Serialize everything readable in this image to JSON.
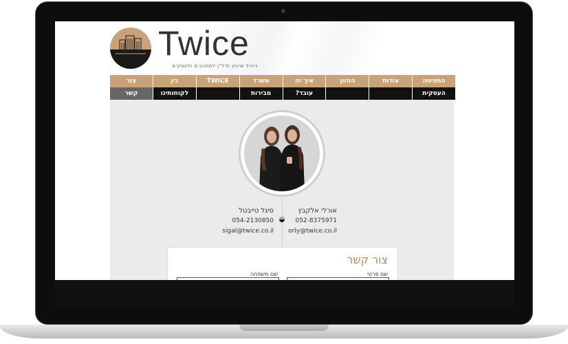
{
  "site": {
    "brand": "Twice",
    "tagline": "ניהול שיווק נדל\"ן למתווכים ולעסקים"
  },
  "nav": [
    {
      "top": "התפיסה",
      "bottom": "העסקית",
      "name": "nav-item-concept"
    },
    {
      "top": "אודות",
      "bottom": "",
      "name": "nav-item-about"
    },
    {
      "top": "החזון",
      "bottom": "",
      "name": "nav-item-vision"
    },
    {
      "top": "איך זה",
      "bottom": "עובד?",
      "name": "nav-item-how-it-works"
    },
    {
      "top": "משרד",
      "bottom": "מבירות",
      "name": "nav-item-office"
    },
    {
      "top": "TWICE",
      "bottom": "",
      "name": "nav-item-twice"
    },
    {
      "top": "בין",
      "bottom": "לקוחותינו",
      "name": "nav-item-clients"
    },
    {
      "top": "צור",
      "bottom": "קשר",
      "name": "nav-item-contact"
    }
  ],
  "people": {
    "right": {
      "name": "אורלי אלקבץ",
      "phone": "052-8375971",
      "email": "orly@twice.co.il"
    },
    "left": {
      "name": "סיגל טייבטל",
      "phone": "054-2130850",
      "email": "sigal@twice.co.il"
    }
  },
  "contact_form": {
    "title": "צור קשר",
    "first_name_label": "שם פרטי",
    "last_name_label": "שם משפחה"
  },
  "colors": {
    "accent": "#c9a277",
    "dark": "#111111",
    "active_tab": "#666666"
  }
}
